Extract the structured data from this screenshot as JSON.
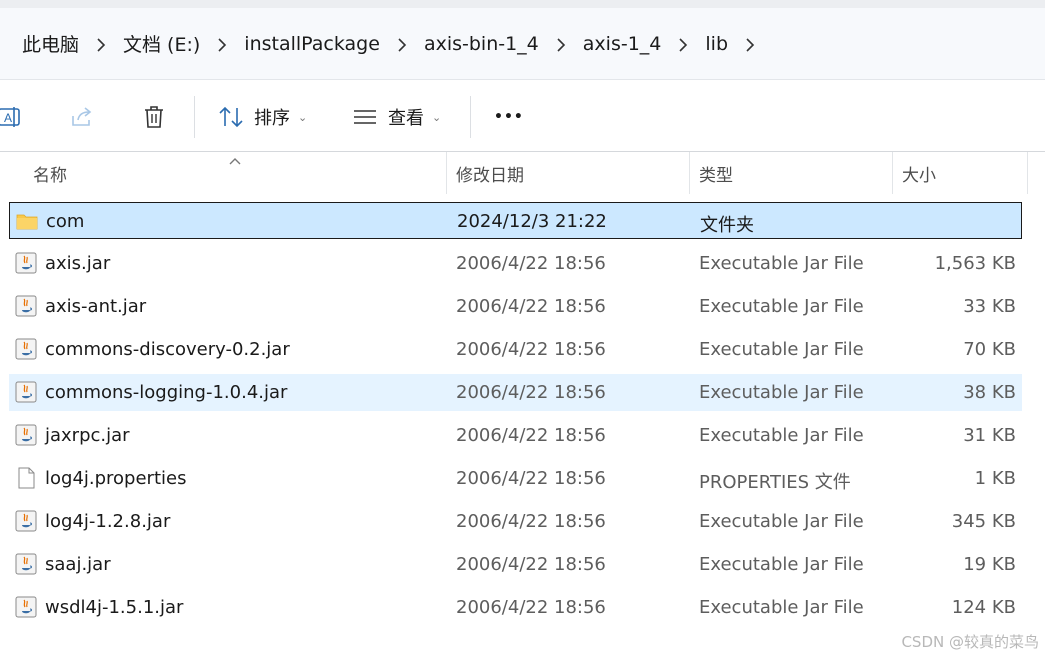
{
  "breadcrumb": [
    "此电脑",
    "文档 (E:)",
    "installPackage",
    "axis-bin-1_4",
    "axis-1_4",
    "lib"
  ],
  "toolbar": {
    "sort_label": "排序",
    "view_label": "查看",
    "more_label": "•••"
  },
  "columns": {
    "name": "名称",
    "modified": "修改日期",
    "type": "类型",
    "size": "大小"
  },
  "files": [
    {
      "name": "com",
      "modified": "2024/12/3 21:22",
      "type": "文件夹",
      "size": "",
      "icon": "folder-icon",
      "state": "selected"
    },
    {
      "name": "axis.jar",
      "modified": "2006/4/22 18:56",
      "type": "Executable Jar File",
      "size": "1,563 KB",
      "icon": "jar-icon",
      "state": ""
    },
    {
      "name": "axis-ant.jar",
      "modified": "2006/4/22 18:56",
      "type": "Executable Jar File",
      "size": "33 KB",
      "icon": "jar-icon",
      "state": ""
    },
    {
      "name": "commons-discovery-0.2.jar",
      "modified": "2006/4/22 18:56",
      "type": "Executable Jar File",
      "size": "70 KB",
      "icon": "jar-icon",
      "state": ""
    },
    {
      "name": "commons-logging-1.0.4.jar",
      "modified": "2006/4/22 18:56",
      "type": "Executable Jar File",
      "size": "38 KB",
      "icon": "jar-icon",
      "state": "hover"
    },
    {
      "name": "jaxrpc.jar",
      "modified": "2006/4/22 18:56",
      "type": "Executable Jar File",
      "size": "31 KB",
      "icon": "jar-icon",
      "state": ""
    },
    {
      "name": "log4j.properties",
      "modified": "2006/4/22 18:56",
      "type": "PROPERTIES 文件",
      "size": "1 KB",
      "icon": "file-icon",
      "state": ""
    },
    {
      "name": "log4j-1.2.8.jar",
      "modified": "2006/4/22 18:56",
      "type": "Executable Jar File",
      "size": "345 KB",
      "icon": "jar-icon",
      "state": ""
    },
    {
      "name": "saaj.jar",
      "modified": "2006/4/22 18:56",
      "type": "Executable Jar File",
      "size": "19 KB",
      "icon": "jar-icon",
      "state": ""
    },
    {
      "name": "wsdl4j-1.5.1.jar",
      "modified": "2006/4/22 18:56",
      "type": "Executable Jar File",
      "size": "124 KB",
      "icon": "jar-icon",
      "state": ""
    }
  ],
  "watermark": "CSDN @较真的菜鸟",
  "colors": {
    "selected_bg": "#cce8ff",
    "hover_bg": "#e5f3ff",
    "folder": "#f8c94a"
  }
}
